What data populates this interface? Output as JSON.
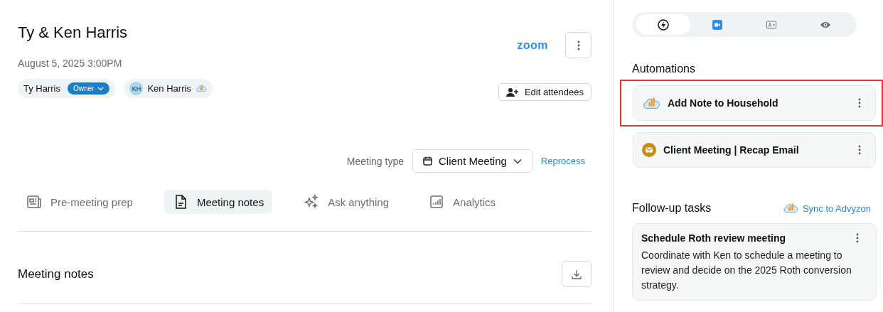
{
  "meeting": {
    "title": "Ty & Ken Harris",
    "datetime": "August 5, 2025 3:00PM",
    "platform": "zoom",
    "attendees": [
      {
        "name": "Ty Harris",
        "role": "Owner",
        "crm_linked": false
      },
      {
        "name": "Ken Harris",
        "initials": "KH",
        "crm_linked": true
      }
    ],
    "edit_attendees": "Edit attendees",
    "meeting_type_label": "Meeting type",
    "meeting_type": "Client Meeting",
    "reprocess": "Reprocess"
  },
  "tabs": [
    {
      "label": "Pre-meeting prep",
      "selected": false
    },
    {
      "label": "Meeting notes",
      "selected": true
    },
    {
      "label": "Ask anything",
      "selected": false
    },
    {
      "label": "Analytics",
      "selected": false
    }
  ],
  "notes_heading": "Meeting notes",
  "side_tabs": [
    {
      "selected": true
    },
    {
      "selected": false
    },
    {
      "selected": false
    },
    {
      "selected": false
    }
  ],
  "automations": {
    "heading": "Automations",
    "items": [
      {
        "label": "Add Note to Household",
        "highlighted": true
      },
      {
        "label": "Client Meeting | Recap Email",
        "highlighted": false
      }
    ]
  },
  "follow_up": {
    "heading": "Follow-up tasks",
    "sync": "Sync to Advyzon",
    "tasks": [
      {
        "title": "Schedule Roth review meeting",
        "description": "Coordinate with Ken to schedule a meeting to review and decide on the 2025 Roth conversion strategy."
      }
    ]
  }
}
